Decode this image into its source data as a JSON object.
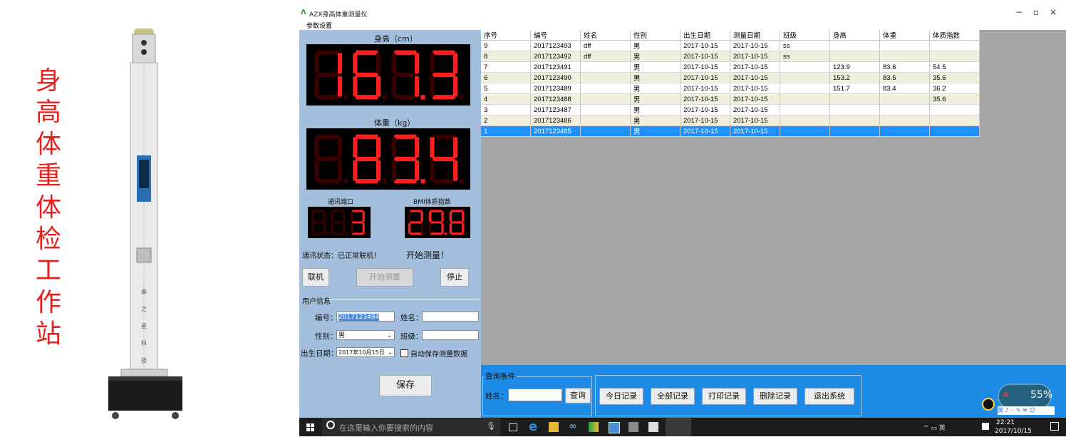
{
  "side_title": [
    "身",
    "高",
    "体",
    "重",
    "体",
    "检",
    "工",
    "作",
    "站"
  ],
  "device": {
    "brand_vertical": [
      "奥",
      "之",
      "星",
      "科",
      "技"
    ]
  },
  "window": {
    "title": "AZX身高体重测量仪",
    "menu": "参数设置",
    "controls": {
      "minimize": "−",
      "maximize": "▫",
      "close": "×"
    }
  },
  "left": {
    "height_label": "身高（cm）",
    "height_value": "167.3",
    "weight_label": "体重（kg）",
    "weight_value": "83.4",
    "port_label": "通讯端口",
    "port_value": "3",
    "bmi_label": "BMI体质指数",
    "bmi_value": "29.8",
    "status_text": "通讯状态：已正常联机！",
    "measure_text": "开始测量！",
    "btn_connect": "联机",
    "btn_start": "开始测量",
    "btn_stop": "停止",
    "user_group": "用户信息",
    "id_label": "编号：",
    "id_value": "2017123494",
    "name_label": "姓名：",
    "name_value": "",
    "gender_label": "性别：",
    "gender_value": "男",
    "class_label": "班级：",
    "class_value": "",
    "birth_label": "出生日期：",
    "birth_value": "2017年10月15日",
    "autosave_label": "自动保存测量数据",
    "btn_save": "保存"
  },
  "table": {
    "headers": [
      "序号",
      "编号",
      "姓名",
      "性别",
      "出生日期",
      "测量日期",
      "班级",
      "身高",
      "体重",
      "体质指数"
    ],
    "rows": [
      [
        "9",
        "2017123493",
        "dff",
        "男",
        "2017-10-15",
        "2017-10-15",
        "ss",
        "",
        "",
        ""
      ],
      [
        "8",
        "2017123492",
        "dff",
        "男",
        "2017-10-15",
        "2017-10-15",
        "ss",
        "",
        "",
        ""
      ],
      [
        "7",
        "2017123491",
        "",
        "男",
        "2017-10-15",
        "2017-10-15",
        "",
        "123.9",
        "83.6",
        "54.5"
      ],
      [
        "6",
        "2017123490",
        "",
        "男",
        "2017-10-15",
        "2017-10-15",
        "",
        "153.2",
        "83.5",
        "35.6"
      ],
      [
        "5",
        "2017123489",
        "",
        "男",
        "2017-10-15",
        "2017-10-15",
        "",
        "151.7",
        "83.4",
        "36.2"
      ],
      [
        "4",
        "2017123488",
        "",
        "男",
        "2017-10-15",
        "2017-10-15",
        "",
        "",
        "",
        "35.6"
      ],
      [
        "3",
        "2017123487",
        "",
        "男",
        "2017-10-15",
        "2017-10-15",
        "",
        "",
        "",
        ""
      ],
      [
        "2",
        "2017123486",
        "",
        "男",
        "2017-10-15",
        "2017-10-15",
        "",
        "",
        "",
        ""
      ],
      [
        "1",
        "2017123485",
        "",
        "男",
        "2017-10-15",
        "2017-10-15",
        "",
        "",
        "",
        ""
      ]
    ],
    "selected_row_index": 8
  },
  "query": {
    "group_label": "查询条件",
    "name_label": "姓名：",
    "name_value": "",
    "btn_search": "查询"
  },
  "actions": [
    "今日记录",
    "全部记录",
    "打印记录",
    "删除记录",
    "退出系统"
  ],
  "taskbar": {
    "search_placeholder": "在这里输入你要搜索的内容",
    "tray_text": "^ ▭ 英",
    "time": "22:21",
    "date": "2017/10/15",
    "percent": "55%"
  },
  "colors": {
    "accent": "#1e8ce6",
    "lcd_on": "#ff1f1f",
    "lcd_off": "#3a0000",
    "panel": "#a3bfdd",
    "side_title": "#e8201c"
  }
}
